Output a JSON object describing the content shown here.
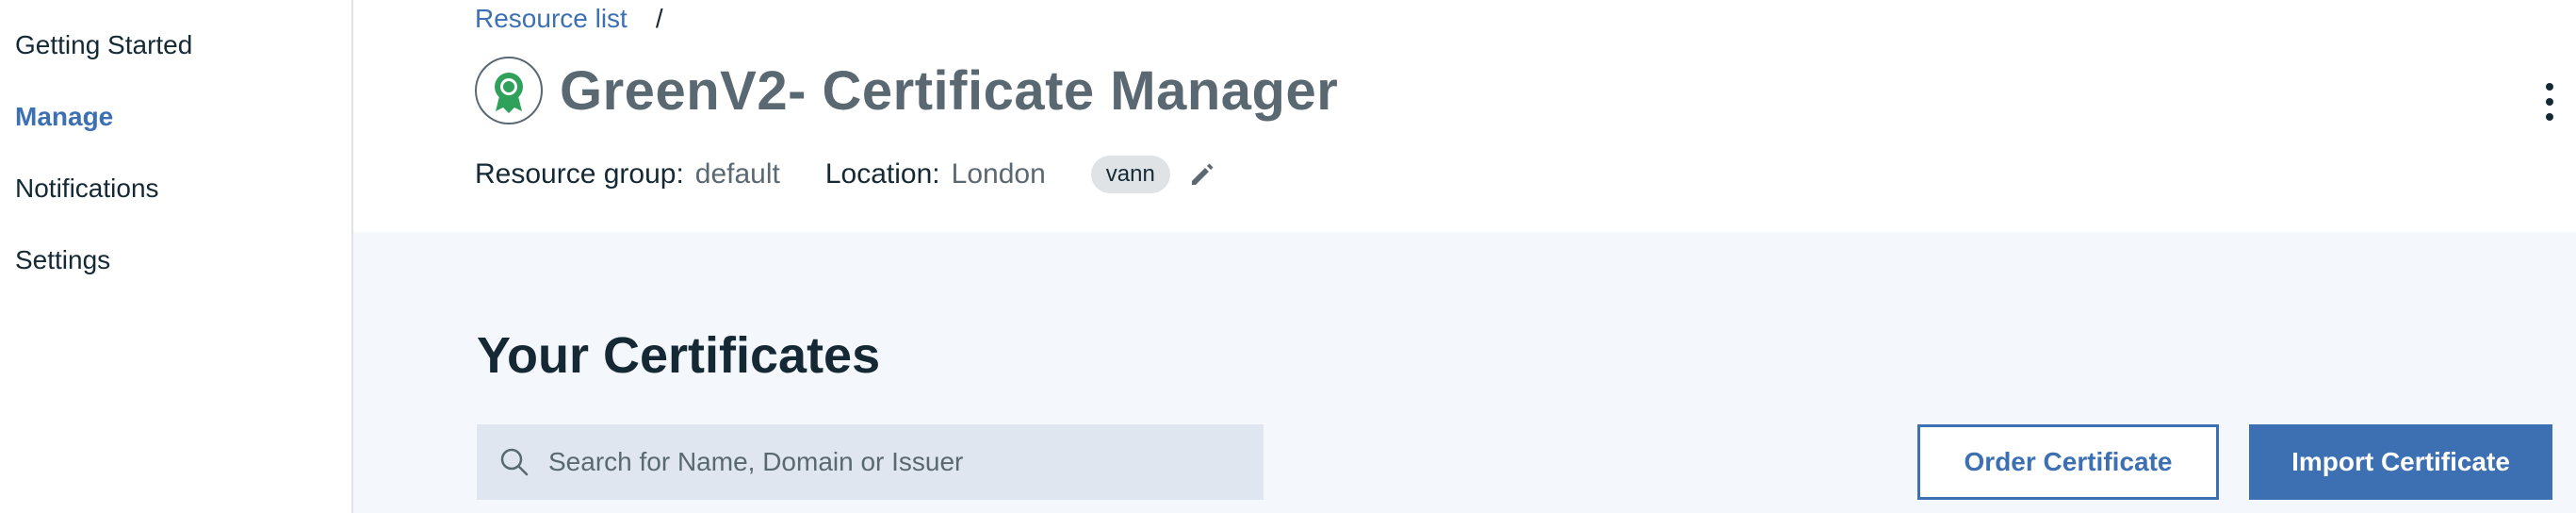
{
  "sidebar": {
    "items": [
      {
        "label": "Getting Started",
        "active": false
      },
      {
        "label": "Manage",
        "active": true
      },
      {
        "label": "Notifications",
        "active": false
      },
      {
        "label": "Settings",
        "active": false
      }
    ]
  },
  "breadcrumb": {
    "link": "Resource list",
    "separator": "/"
  },
  "header": {
    "service_icon": "certificate-ribbon-icon",
    "title": "GreenV2- Certificate Manager",
    "resource_group_label": "Resource group:",
    "resource_group_value": "default",
    "location_label": "Location:",
    "location_value": "London",
    "tag": "vann",
    "edit_icon": "pencil-icon",
    "overflow_icon": "overflow-menu-vertical-icon"
  },
  "main": {
    "section_title": "Your Certificates",
    "search_placeholder": "Search for Name, Domain or Issuer",
    "search_icon": "search-icon",
    "order_button": "Order Certificate",
    "import_button": "Import Certificate"
  },
  "colors": {
    "accent": "#3d70b2",
    "content_bg": "#f4f7fb",
    "icon_green": "#2fa15a"
  }
}
